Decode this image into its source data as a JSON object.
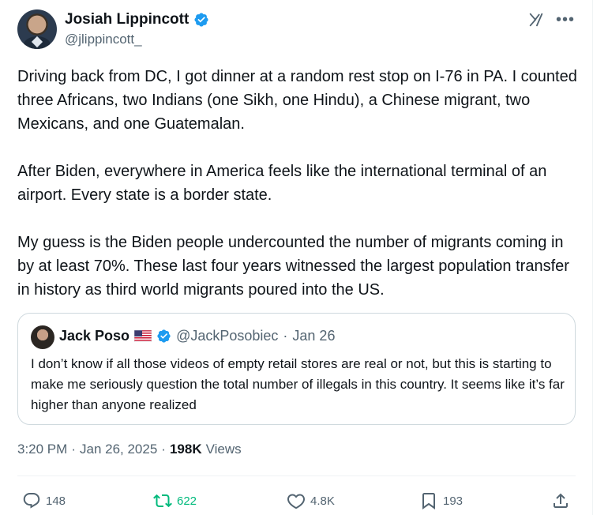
{
  "author": {
    "display_name": "Josiah Lippincott",
    "handle": "@jlippincott_",
    "verified": true
  },
  "icons": {
    "verified": "verified-badge-icon",
    "grok": "grok-icon",
    "more": "more-icon",
    "reply": "reply-icon",
    "repost": "repost-icon",
    "like": "like-icon",
    "bookmark": "bookmark-icon",
    "share": "share-icon"
  },
  "more_glyph": "•••",
  "tweet_text": {
    "paragraph_1": "Driving back from DC, I got dinner at a random rest stop on I-76 in PA. I counted three Africans, two Indians (one Sikh, one Hindu), a Chinese migrant, two Mexicans, and one Guatemalan.",
    "paragraph_2": "After Biden, everywhere in America feels like the international terminal of an airport. Every state is a border state.",
    "paragraph_3": "My guess is the Biden people undercounted the number of migrants coming in by at least 70%. These last four years witnessed the largest population transfer in history as third world migrants poured into the US."
  },
  "quoted_tweet": {
    "display_name": "Jack Poso",
    "flag": "us-flag",
    "handle": "@JackPosobiec",
    "separator": "·",
    "date": "Jan 26",
    "text": "I don’t know if all those videos of empty retail stores are real or not, but this is starting to make me seriously question the total number of illegals in this country. It seems like it’s far higher than anyone realized"
  },
  "meta": {
    "time": "3:20 PM",
    "separator": "·",
    "date": "Jan 26, 2025",
    "separator_2": "·",
    "views_count": "198K",
    "views_label": "Views"
  },
  "actions": {
    "reply_count": "148",
    "repost_count": "622",
    "like_count": "4.8K",
    "bookmark_count": "193"
  },
  "colors": {
    "text": "#0f1419",
    "secondary": "#536471",
    "verified_blue": "#1d9bf0",
    "repost_green": "#00ba7c",
    "border": "#cfd9de"
  }
}
